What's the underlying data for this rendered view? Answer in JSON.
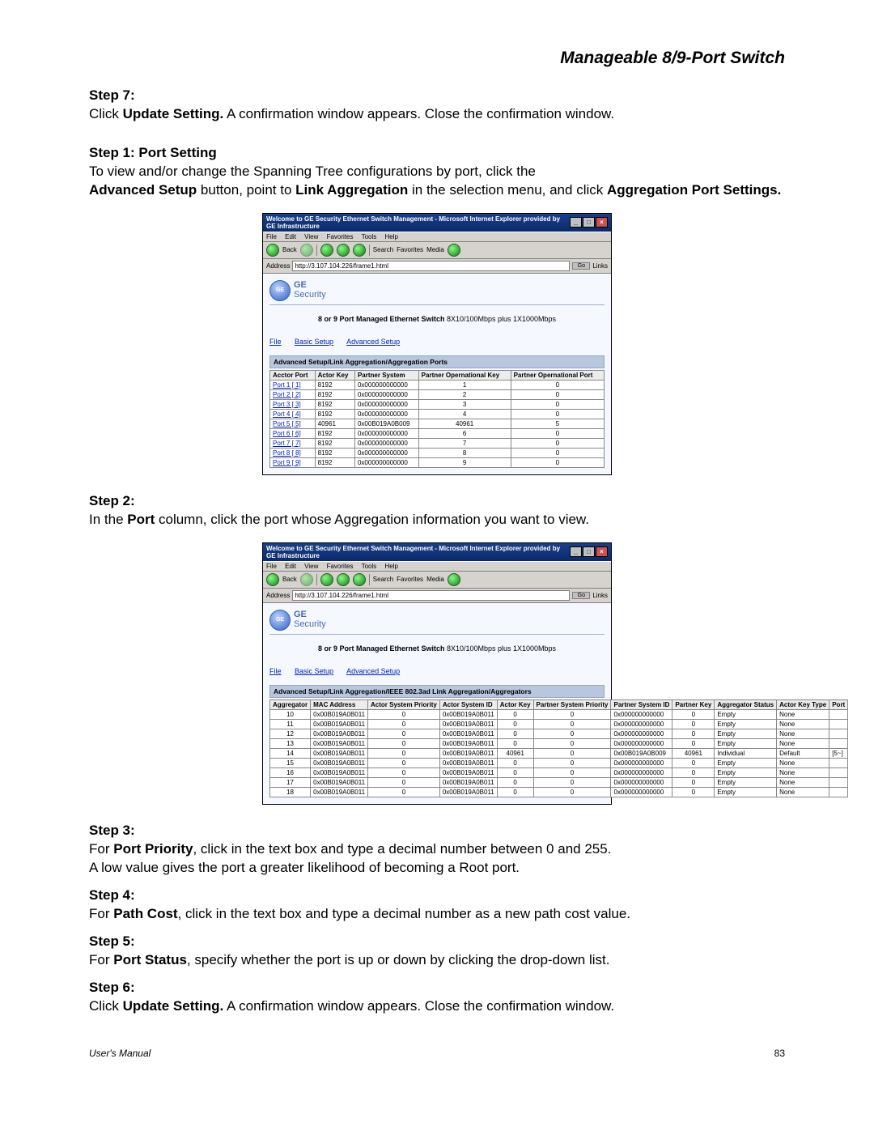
{
  "doc_title": "Manageable 8/9-Port Switch",
  "steps": {
    "s7_head": "Step 7:",
    "s7_line_a": "Click ",
    "s7_bold": "Update Setting.",
    "s7_line_b": " A confirmation window appears. Close the confirmation window.",
    "s1_head": "Step 1: Port Setting",
    "s1_line_a": "To view and/or change the Spanning Tree configurations by port, click the",
    "s1_line_b_a": "Advanced Setup",
    "s1_line_b_b": " button, point to ",
    "s1_line_b_c": "Link Aggregation",
    "s1_line_b_d": " in the selection menu, and click ",
    "s1_line_b_e": "Aggregation Port Settings.",
    "s2_head": "Step 2:",
    "s2_line_a": "In the ",
    "s2_bold": "Port",
    "s2_line_b": " column, click the port whose Aggregation information you want to view.",
    "s3_head": "Step 3:",
    "s3_line_a": "For ",
    "s3_bold": "Port Priority",
    "s3_line_b": ", click in the text box and type a decimal number between 0 and 255.",
    "s3_line2": "A low value gives the port a greater likelihood of becoming a Root port.",
    "s4_head": "Step 4:",
    "s4_line_a": "For ",
    "s4_bold": "Path Cost",
    "s4_line_b": ", click in the text box and type a decimal number as a new path cost value.",
    "s5_head": "Step 5:",
    "s5_line_a": "For ",
    "s5_bold": "Port Status",
    "s5_line_b": ", specify whether the port is up or down by clicking the drop-down list.",
    "s6_head": "Step 6:",
    "s6_line_a": "Click ",
    "s6_bold": "Update Setting.",
    "s6_line_b": " A confirmation window appears. Close the confirmation window."
  },
  "browser": {
    "title": "Welcome to GE Security Ethernet Switch Management - Microsoft Internet Explorer provided by GE Infrastructure",
    "menu": [
      "File",
      "Edit",
      "View",
      "Favorites",
      "Tools",
      "Help"
    ],
    "tool_items": [
      "Back",
      "Search",
      "Favorites",
      "Media"
    ],
    "addr_label": "Address",
    "addr_value": "http://3.107.104.226/frame1.html",
    "go": "Go",
    "links": "Links"
  },
  "brand": {
    "ge": "GE",
    "sec": "Security"
  },
  "device": {
    "name_bold": "8 or 9 Port Managed Ethernet Switch",
    "name_rest": "  8X10/100Mbps plus 1X1000Mbps"
  },
  "nav": {
    "file": "File",
    "basic": "Basic Setup",
    "adv": "Advanced Setup"
  },
  "shot1": {
    "crumb": "Advanced Setup/Link Aggregation/Aggregation Ports",
    "headers": [
      "Acctor Port",
      "Actor Key",
      "Partner System",
      "Partner Opernational Key",
      "Partner Opernational Port"
    ],
    "rows": [
      {
        "port": "Port 1 [ 1]",
        "key": "8192",
        "psys": "0x000000000000",
        "pok": "1",
        "pop": "0"
      },
      {
        "port": "Port 2 [ 2]",
        "key": "8192",
        "psys": "0x000000000000",
        "pok": "2",
        "pop": "0"
      },
      {
        "port": "Port 3 [ 3]",
        "key": "8192",
        "psys": "0x000000000000",
        "pok": "3",
        "pop": "0"
      },
      {
        "port": "Port 4 [ 4]",
        "key": "8192",
        "psys": "0x000000000000",
        "pok": "4",
        "pop": "0"
      },
      {
        "port": "Port 5 [ 5]",
        "key": "40961",
        "psys": "0x00B019A0B009",
        "pok": "40961",
        "pop": "5"
      },
      {
        "port": "Port 6 [ 6]",
        "key": "8192",
        "psys": "0x000000000000",
        "pok": "6",
        "pop": "0"
      },
      {
        "port": "Port 7 [ 7]",
        "key": "8192",
        "psys": "0x000000000000",
        "pok": "7",
        "pop": "0"
      },
      {
        "port": "Port 8 [ 8]",
        "key": "8192",
        "psys": "0x000000000000",
        "pok": "8",
        "pop": "0"
      },
      {
        "port": "Port 9 [ 9]",
        "key": "8192",
        "psys": "0x000000000000",
        "pok": "9",
        "pop": "0"
      }
    ]
  },
  "shot2": {
    "crumb": "Advanced Setup/Link Aggregation/IEEE 802.3ad Link Aggregation/Aggregators",
    "headers": [
      "Aggregator",
      "MAC Address",
      "Actor System Priority",
      "Actor System ID",
      "Actor Key",
      "Partner System Priority",
      "Partner System ID",
      "Partner Key",
      "Aggregator Status",
      "Actor Key Type",
      "Port"
    ],
    "rows": [
      {
        "agg": "10",
        "mac": "0x00B019A0B011",
        "asp": "0",
        "asid": "0x00B019A0B011",
        "ak": "0",
        "psp": "0",
        "psid": "0x000000000000",
        "pk": "0",
        "stat": "Empty",
        "akt": "None",
        "port": ""
      },
      {
        "agg": "11",
        "mac": "0x00B019A0B011",
        "asp": "0",
        "asid": "0x00B019A0B011",
        "ak": "0",
        "psp": "0",
        "psid": "0x000000000000",
        "pk": "0",
        "stat": "Empty",
        "akt": "None",
        "port": ""
      },
      {
        "agg": "12",
        "mac": "0x00B019A0B011",
        "asp": "0",
        "asid": "0x00B019A0B011",
        "ak": "0",
        "psp": "0",
        "psid": "0x000000000000",
        "pk": "0",
        "stat": "Empty",
        "akt": "None",
        "port": ""
      },
      {
        "agg": "13",
        "mac": "0x00B019A0B011",
        "asp": "0",
        "asid": "0x00B019A0B011",
        "ak": "0",
        "psp": "0",
        "psid": "0x000000000000",
        "pk": "0",
        "stat": "Empty",
        "akt": "None",
        "port": ""
      },
      {
        "agg": "14",
        "mac": "0x00B019A0B011",
        "asp": "0",
        "asid": "0x00B019A0B011",
        "ak": "40961",
        "psp": "0",
        "psid": "0x00B019A0B009",
        "pk": "40961",
        "stat": "Individual",
        "akt": "Default",
        "port": "[5~]"
      },
      {
        "agg": "15",
        "mac": "0x00B019A0B011",
        "asp": "0",
        "asid": "0x00B019A0B011",
        "ak": "0",
        "psp": "0",
        "psid": "0x000000000000",
        "pk": "0",
        "stat": "Empty",
        "akt": "None",
        "port": ""
      },
      {
        "agg": "16",
        "mac": "0x00B019A0B011",
        "asp": "0",
        "asid": "0x00B019A0B011",
        "ak": "0",
        "psp": "0",
        "psid": "0x000000000000",
        "pk": "0",
        "stat": "Empty",
        "akt": "None",
        "port": ""
      },
      {
        "agg": "17",
        "mac": "0x00B019A0B011",
        "asp": "0",
        "asid": "0x00B019A0B011",
        "ak": "0",
        "psp": "0",
        "psid": "0x000000000000",
        "pk": "0",
        "stat": "Empty",
        "akt": "None",
        "port": ""
      },
      {
        "agg": "18",
        "mac": "0x00B019A0B011",
        "asp": "0",
        "asid": "0x00B019A0B011",
        "ak": "0",
        "psp": "0",
        "psid": "0x000000000000",
        "pk": "0",
        "stat": "Empty",
        "akt": "None",
        "port": ""
      }
    ]
  },
  "footer": {
    "left": "User's Manual",
    "right": "83"
  }
}
